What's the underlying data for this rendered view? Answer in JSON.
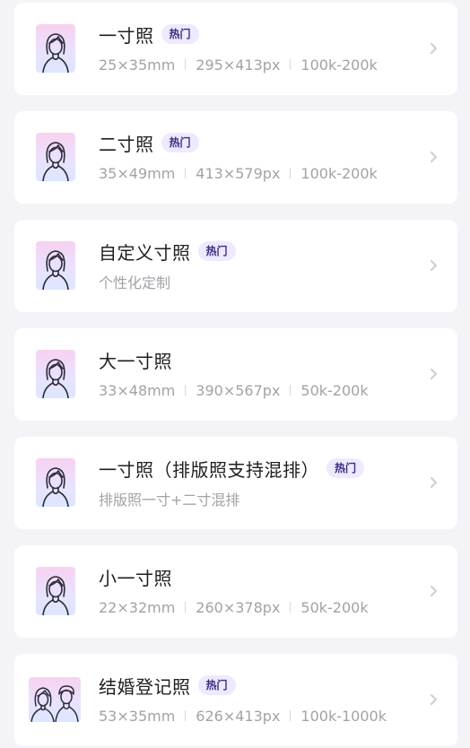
{
  "hot_label": "热门",
  "colors": {
    "hot_bg": "#efe9ff",
    "hot_text": "#3f2c80",
    "card_bg": "#ffffff",
    "page_bg": "#f4f4f8"
  },
  "items": [
    {
      "title": "一寸照",
      "hot": true,
      "icon": "person-portrait-icon",
      "specs": [
        "25×35mm",
        "295×413px",
        "100k-200k"
      ]
    },
    {
      "title": "二寸照",
      "hot": true,
      "icon": "person-portrait-icon",
      "specs": [
        "35×49mm",
        "413×579px",
        "100k-200k"
      ]
    },
    {
      "title": "自定义寸照",
      "hot": true,
      "icon": "person-portrait-icon",
      "subtitle": "个性化定制"
    },
    {
      "title": "大一寸照",
      "hot": false,
      "icon": "person-portrait-icon",
      "specs": [
        "33×48mm",
        "390×567px",
        "50k-200k"
      ]
    },
    {
      "title": "一寸照（排版照支持混排）",
      "hot": true,
      "icon": "person-portrait-icon",
      "subtitle": "排版照一寸+二寸混排"
    },
    {
      "title": "小一寸照",
      "hot": false,
      "icon": "person-portrait-icon",
      "specs": [
        "22×32mm",
        "260×378px",
        "50k-200k"
      ]
    },
    {
      "title": "结婚登记照",
      "hot": true,
      "icon": "couple-portrait-icon",
      "specs": [
        "53×35mm",
        "626×413px",
        "100k-1000k"
      ]
    }
  ]
}
